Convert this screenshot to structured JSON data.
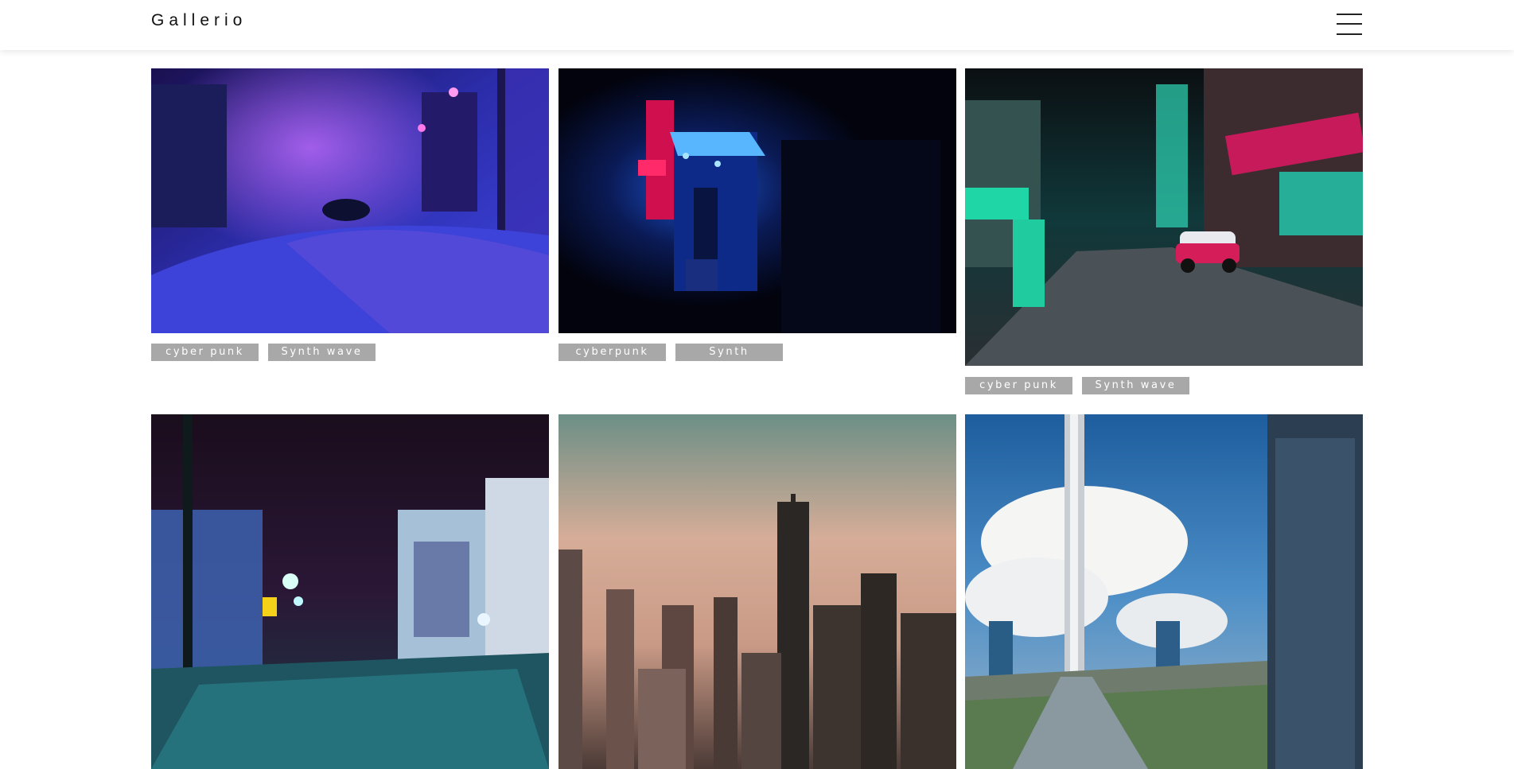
{
  "header": {
    "brand": "Gallerio",
    "menu_icon": "hamburger-menu-icon"
  },
  "gallery": {
    "cards": [
      {
        "image": "neon-street-night-blue-purple",
        "tags": [
          "cyber punk",
          "Synth wave"
        ]
      },
      {
        "image": "neon-shopfront-dark-alley",
        "tags": [
          "cyberpunk",
          "Synth"
        ]
      },
      {
        "image": "neon-market-street-taxi-teal",
        "tags": [
          "cyber punk",
          "Synth wave"
        ]
      },
      {
        "image": "rainy-street-teal-lights-night",
        "tags": []
      },
      {
        "image": "city-skyline-sunset-haze",
        "tags": []
      },
      {
        "image": "skyscraper-clouds-blue-sky",
        "tags": []
      }
    ]
  }
}
